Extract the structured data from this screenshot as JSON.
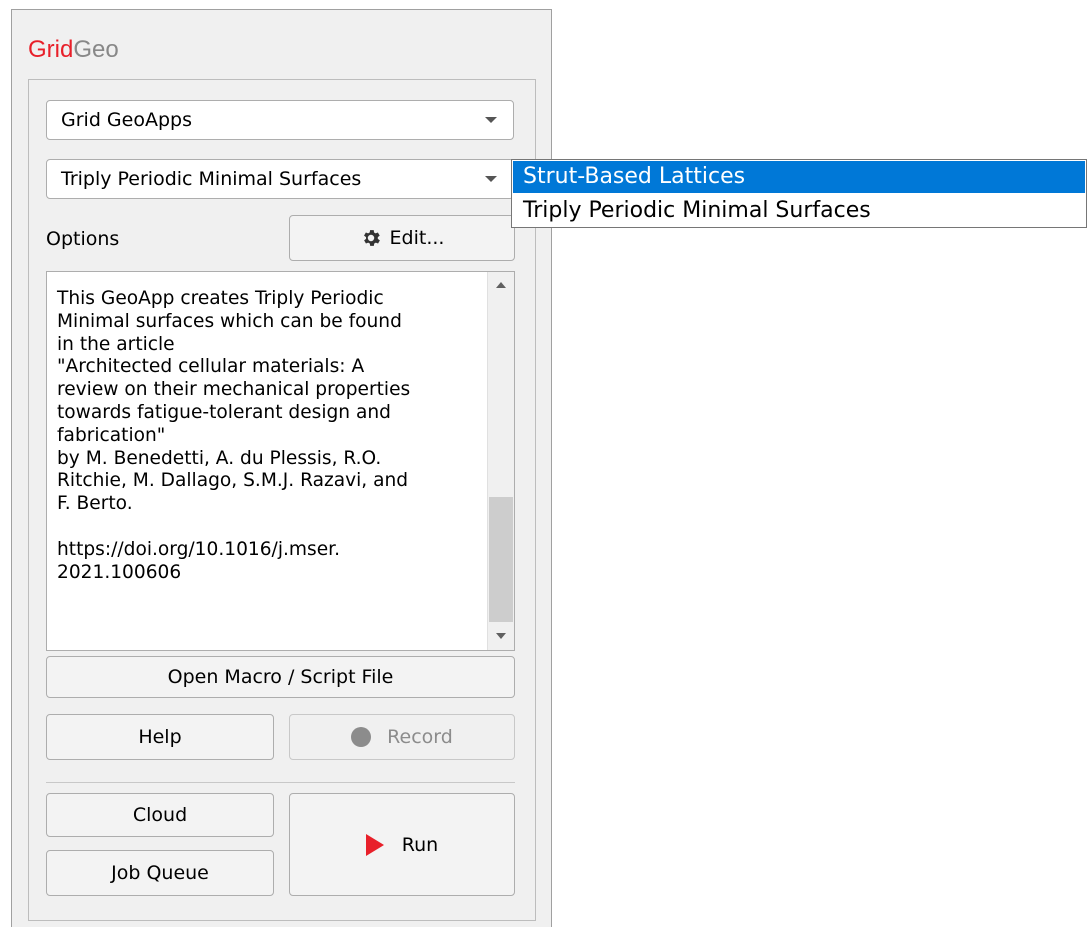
{
  "brand": {
    "part1": "Grid",
    "part2": "Geo"
  },
  "app_combo": {
    "value": "Grid GeoApps"
  },
  "geoapp_combo": {
    "value": "Triply Periodic Minimal Surfaces"
  },
  "options": {
    "label": "Options",
    "edit_label": "Edit..."
  },
  "description": "This GeoApp creates Triply Periodic\nMinimal surfaces which can be found\nin the article\n\"Architected cellular materials: A\nreview on their mechanical properties\ntowards fatigue-tolerant design and\nfabrication\"\nby M. Benedetti, A. du Plessis, R.O.\nRitchie, M. Dallago, S.M.J. Razavi, and\nF. Berto.\n\nhttps://doi.org/10.1016/j.mser.\n2021.100606",
  "buttons": {
    "open_macro": "Open Macro / Script File",
    "help": "Help",
    "record": "Record",
    "cloud": "Cloud",
    "job_queue": "Job Queue",
    "run": "Run"
  },
  "dropdown": {
    "items": [
      "Strut-Based Lattices",
      "Triply Periodic Minimal Surfaces"
    ],
    "selected_index": 0
  },
  "colors": {
    "brand_red": "#e8202a",
    "brand_gray": "#888888",
    "selection_blue": "#0078d7"
  },
  "icons": {
    "edit": "gear-icon",
    "record": "record-dot-icon",
    "run": "play-icon"
  }
}
